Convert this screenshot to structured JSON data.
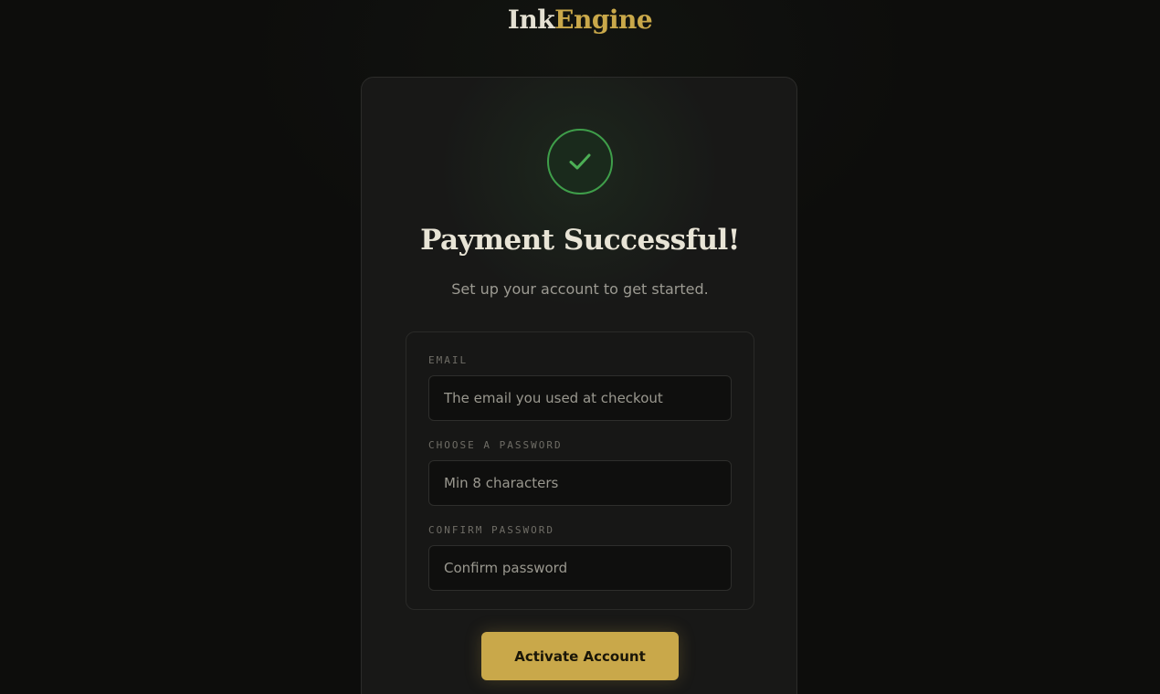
{
  "brand": {
    "part1": "Ink",
    "part2": "Engine",
    "colors": {
      "primary": "#e4e0d2",
      "accent": "#c9a84a"
    }
  },
  "status": {
    "icon": "check-icon",
    "color": "#3f9e4a"
  },
  "heading": {
    "title": "Payment Successful!",
    "subtitle": "Set up your account to get started."
  },
  "form": {
    "email": {
      "label": "EMAIL",
      "placeholder": "The email you used at checkout",
      "value": ""
    },
    "password": {
      "label": "CHOOSE A PASSWORD",
      "placeholder": "Min 8 characters",
      "value": ""
    },
    "confirm": {
      "label": "CONFIRM PASSWORD",
      "placeholder": "Confirm password",
      "value": ""
    }
  },
  "actions": {
    "activate_label": "Activate Account"
  }
}
